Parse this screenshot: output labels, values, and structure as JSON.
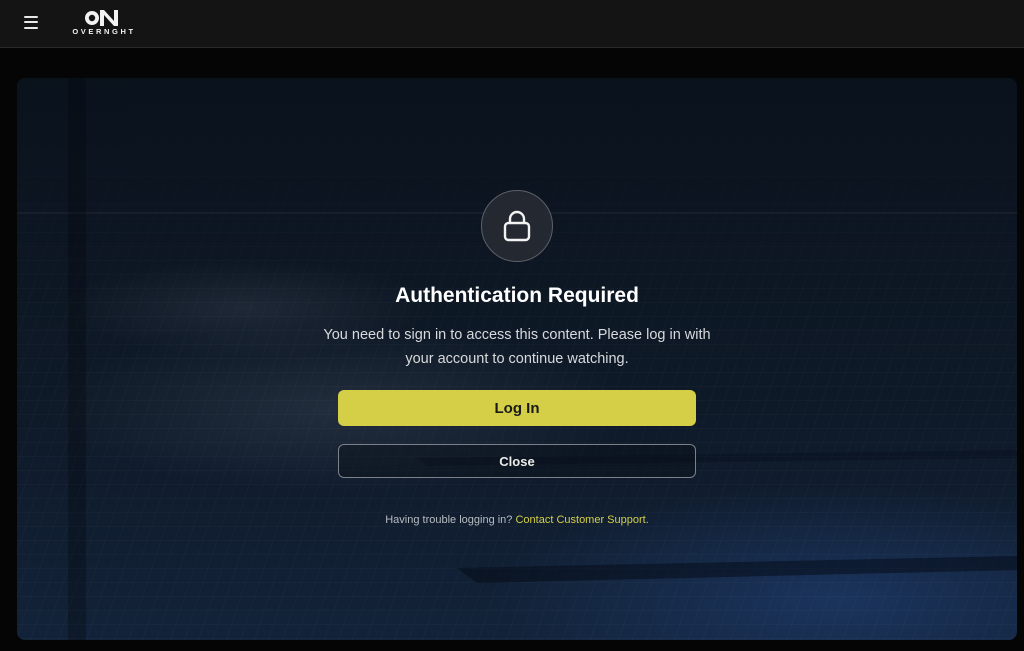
{
  "header": {
    "menu_icon": "hamburger-menu-icon",
    "logo": {
      "mark": "ON",
      "wordmark": "OVERNGHT"
    }
  },
  "modal": {
    "icon": "lock-icon",
    "title": "Authentication Required",
    "description": "You need to sign in to access this content. Please log in with your account to continue watching.",
    "login_label": "Log In",
    "close_label": "Close",
    "help_text": "Having trouble logging in?",
    "help_link": "Contact Customer Support",
    "help_period": "."
  },
  "colors": {
    "accent": "#d4cf46",
    "topbar": "#141414",
    "background": "#050505"
  }
}
